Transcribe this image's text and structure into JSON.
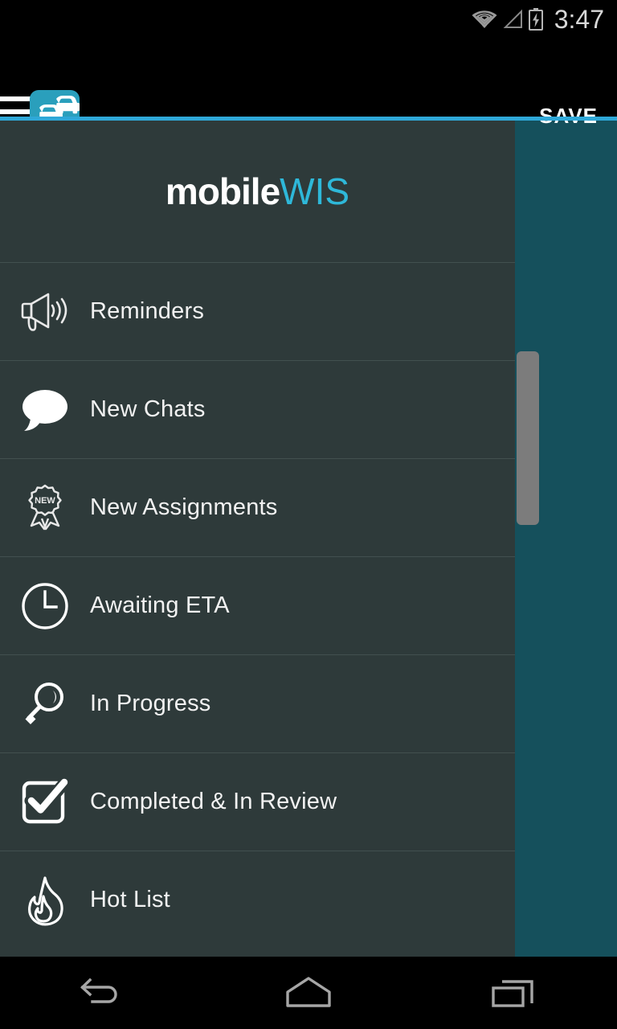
{
  "status_bar": {
    "time": "3:47",
    "icons": [
      "wifi-icon",
      "cell-signal-icon",
      "battery-charging-icon"
    ]
  },
  "action_bar": {
    "menu_icon": "hamburger-menu-icon",
    "logo_icon": "traffic-cars-logo-icon",
    "save_label": "SAVE",
    "accent_color": "#2fa8d8"
  },
  "drawer": {
    "brand": {
      "primary": "mobile",
      "secondary": "WIS",
      "primary_color": "#ffffff",
      "secondary_color": "#2eb8d9"
    },
    "background_color": "#2e3a3a",
    "items": [
      {
        "label": "Reminders",
        "icon": "megaphone-icon"
      },
      {
        "label": "New Chats",
        "icon": "speech-bubble-icon"
      },
      {
        "label": "New Assignments",
        "icon": "new-ribbon-badge-icon",
        "badge_text": "NEW"
      },
      {
        "label": "Awaiting ETA",
        "icon": "clock-icon"
      },
      {
        "label": "In Progress",
        "icon": "magnifying-glass-icon"
      },
      {
        "label": "Completed & In Review",
        "icon": "checkbox-checked-icon"
      },
      {
        "label": "Hot List",
        "icon": "flame-icon"
      }
    ],
    "scrollbar": {
      "visible": true,
      "color": "#7c7c7c"
    }
  },
  "backdrop": {
    "background_color": "#15505c",
    "card_color": "#124754"
  },
  "nav_bar": {
    "buttons": [
      {
        "name": "back-button",
        "icon": "back-arrow-icon"
      },
      {
        "name": "home-button",
        "icon": "home-icon"
      },
      {
        "name": "recents-button",
        "icon": "recents-icon"
      }
    ]
  }
}
